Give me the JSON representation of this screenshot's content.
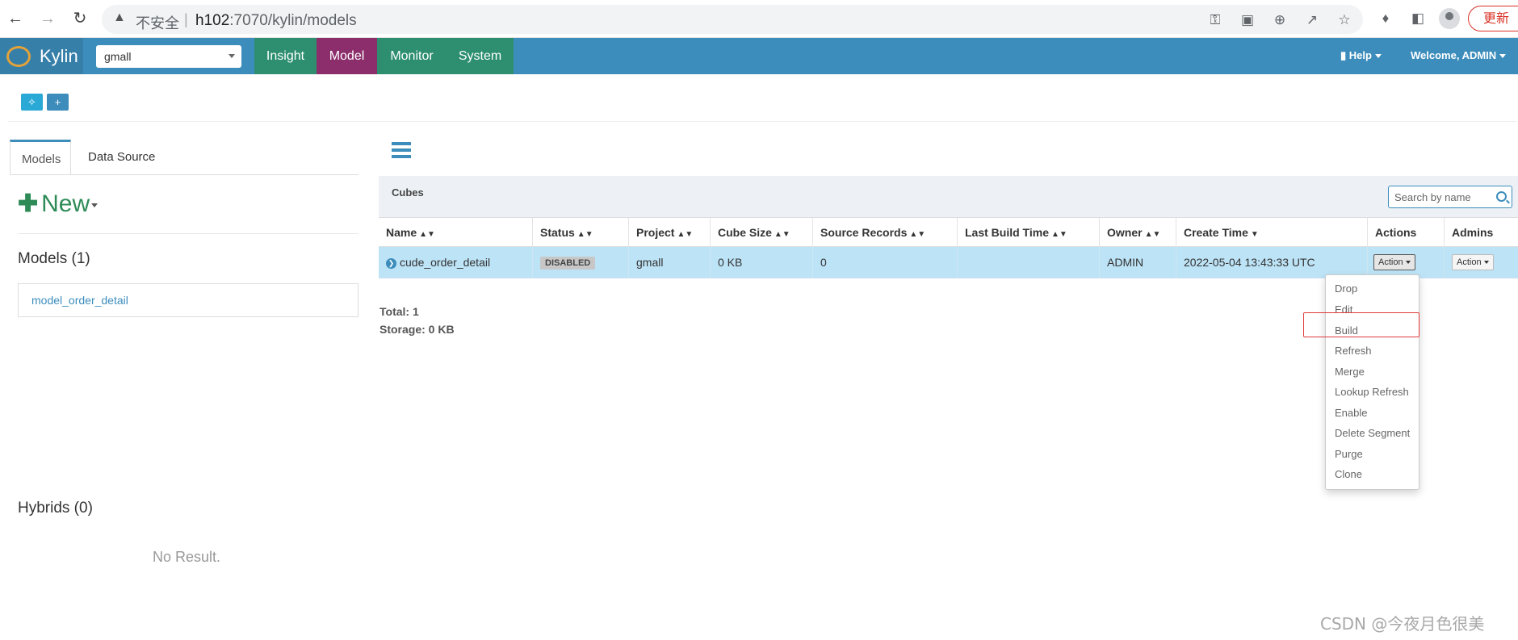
{
  "browser": {
    "insecure_label": "不安全",
    "url_host": "h102",
    "url_rest": ":7070/kylin/models",
    "update_label": "更新"
  },
  "topnav": {
    "brand": "Kylin",
    "project": "gmall",
    "items": [
      "Insight",
      "Model",
      "Monitor",
      "System"
    ],
    "active": "Model",
    "help": "Help",
    "welcome": "Welcome, ADMIN"
  },
  "toolbar": {
    "icons": [
      "cubes-icon",
      "plus-icon"
    ]
  },
  "left": {
    "tabs": [
      "Models",
      "Data Source"
    ],
    "new_label": "New",
    "models_title": "Models (1)",
    "models": [
      "model_order_detail"
    ],
    "hybrids_title": "Hybrids (0)",
    "no_result": "No Result."
  },
  "cubes": {
    "title": "Cubes",
    "search_placeholder": "Search by name",
    "columns": [
      "Name",
      "Status",
      "Project",
      "Cube Size",
      "Source Records",
      "Last Build Time",
      "Owner",
      "Create Time",
      "Actions",
      "Admins"
    ],
    "rows": [
      {
        "name": "cude_order_detail",
        "status": "DISABLED",
        "project": "gmall",
        "cube_size": "0 KB",
        "source_records": "0",
        "last_build_time": "",
        "owner": "ADMIN",
        "create_time": "2022-05-04 13:43:33 UTC",
        "actions_label": "Action",
        "admins_label": "Action"
      }
    ],
    "total": "Total: 1",
    "storage": "Storage: 0 KB"
  },
  "dropdown": {
    "items": [
      "Drop",
      "Edit",
      "Build",
      "Refresh",
      "Merge",
      "Lookup Refresh",
      "Enable",
      "Delete Segment",
      "Purge",
      "Clone"
    ],
    "highlighted": "Build"
  },
  "watermark": "CSDN @今夜月色很美",
  "colors": {
    "nav_bg": "#3c8dbc",
    "nav_item_bg": "#2d8f6f",
    "nav_active_bg": "#8b2e6b",
    "row_selected_bg": "#bde3f6",
    "highlight_border": "#e03a3a"
  }
}
